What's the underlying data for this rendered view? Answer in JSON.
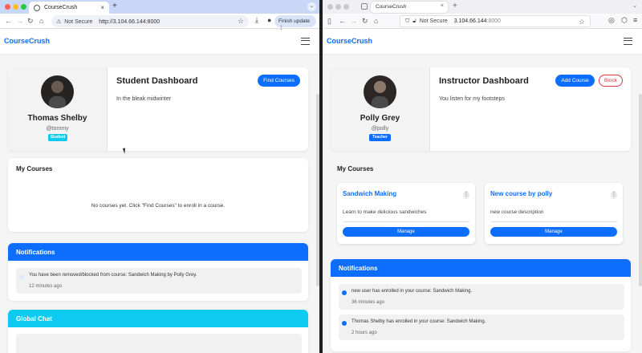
{
  "left_browser": {
    "tab_title": "CourseCrush",
    "tab_close": "×",
    "new_tab": "+",
    "caret": "⌄",
    "security_warning": "Not Secure",
    "url": "http://3.104.66.144:8000",
    "finish_update": "Finish update",
    "colors": {
      "tabbar": "#c7d7f5",
      "close": "#ff5f57",
      "minimize": "#febc2e",
      "maximize": "#28c840"
    }
  },
  "right_browser": {
    "tab_title": "CourseCrush",
    "tab_close": "×",
    "new_tab": "+",
    "security_warning": "Not Secure",
    "url_host": "3.104.66.144",
    "url_port": ":8000"
  },
  "student_app": {
    "brand": "CourseCrush",
    "profile": {
      "name": "Thomas Shelby",
      "username": "@tommy",
      "role": "Student",
      "role_color": "#0dcaf0"
    },
    "dashboard": {
      "title": "Student Dashboard",
      "subtitle": "In the bleak midwinter",
      "find_courses_label": "Find Courses"
    },
    "my_courses": {
      "title": "My Courses",
      "empty_message": "No courses yet. Click \"Find Courses\" to enroll in a course."
    },
    "notifications": {
      "title": "Notifications",
      "items": [
        {
          "text": "You have been removed/blocked from course: Sandwich Making by Polly Grey.",
          "time": "12 minutes ago",
          "read": true
        }
      ]
    },
    "chat": {
      "title": "Global Chat"
    }
  },
  "instructor_app": {
    "brand": "CourseCrush",
    "profile": {
      "name": "Polly Grey",
      "username": "@polly",
      "role": "Teacher",
      "role_color": "#0d6efd"
    },
    "dashboard": {
      "title": "Instructor Dashboard",
      "subtitle": "You listen for my footsteps",
      "add_course_label": "Add Course",
      "block_label": "Block"
    },
    "my_courses": {
      "title": "My Courses",
      "courses": [
        {
          "title": "Sandwich Making",
          "description": "Learn to make delicious sandwiches",
          "manage_label": "Manage",
          "menu": "⋮"
        },
        {
          "title": "New course by polly",
          "description": "new course description",
          "manage_label": "Manage",
          "menu": "⋮"
        }
      ]
    },
    "notifications": {
      "title": "Notifications",
      "items": [
        {
          "text": "new user has enrolled in your course: Sandwich Making.",
          "time": "36 minutes ago",
          "read": false
        },
        {
          "text": "Thomas Shelby has enrolled in your course: Sandwich Making.",
          "time": "2 hours ago",
          "read": false
        }
      ]
    }
  }
}
